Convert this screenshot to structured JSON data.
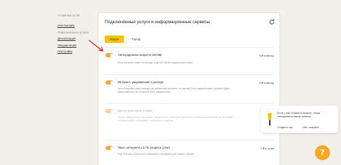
{
  "sidebar": {
    "phone": "+7 905 544-12-78",
    "items": [
      {
        "label": "Мой Билайн"
      },
      {
        "label": "Подключенные услуги"
      },
      {
        "label": "Детализация"
      },
      {
        "label": "Уведомления"
      },
      {
        "label": "Настройки"
      }
    ]
  },
  "card": {
    "title": "Подключённые услуги и информационные сервисы",
    "tabs": {
      "services": "Услуги",
      "tariff": "Тариф"
    }
  },
  "services": [
    {
      "name": "Автопродление скорости 100 МБ",
      "price": "0 ₽ в месяц",
      "desc": "Если интернет-пакет на исходе, ещё 100 МБайт подключатся сами",
      "enabled": true
    },
    {
      "name": "Интернет: уведомления о расходе",
      "price": "0 ₽ в месяц",
      "desc": "Контролируйте свои расходы на мобильный интернет по тарифу. Если каждый пакет трафика будет заканчиваться, вы получите SMS-уведомление",
      "enabled": true
    },
    {
      "name": "Доступ в интернет и MMS",
      "price": "0 ₽ в сутки",
      "desc": "Услуга обязательна к установке. Бесплатные услуги для доступа к мобильному интернету от «Билайн» и приёма MMS сообщений с мобильных номеров",
      "enabled": true,
      "dim": true
    },
    {
      "name": "Пакет интернета 1,5 ГБ (опция в сутки)",
      "price": "0 ₽ в сутки",
      "desc": "Еще больше скоростного мобильного интернета для любого тарифа",
      "enabled": true
    }
  ],
  "popup": {
    "text": "Если у вас появятся вопрос, наши специалисты могут помочь.",
    "open_chat": "Открыть чат",
    "no_thanks": "Нет, спасибо"
  },
  "help": {
    "label": "?"
  },
  "colors": {
    "accent": "#f5c400",
    "toggle": "#f4a73a",
    "help": "#f5a826",
    "arrow": "#e02020"
  }
}
